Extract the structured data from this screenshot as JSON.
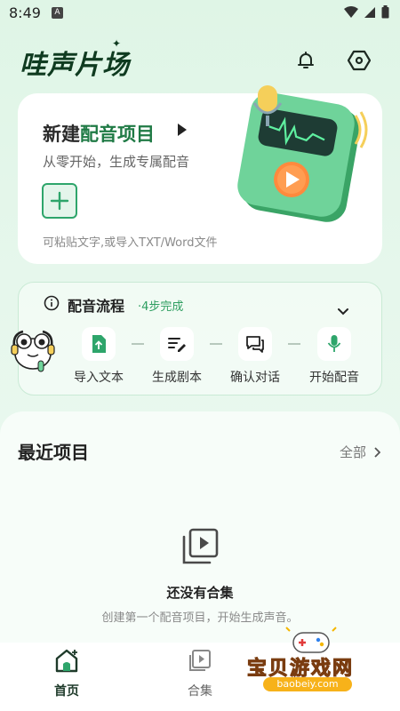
{
  "status": {
    "time": "8:49",
    "a_icon": "A"
  },
  "header": {
    "logo": "哇声片场",
    "bell_icon": "bell-icon",
    "settings_icon": "hexagon-settings-icon"
  },
  "new_project": {
    "title_part1": "新建",
    "title_part2": "配音项目",
    "subtitle": "从零开始，生成专属配音",
    "hint": "可粘贴文字,或导入TXT/Word文件"
  },
  "workflow": {
    "title": "配音流程",
    "steps_label": "·4步完成",
    "steps": [
      {
        "label": "导入文本",
        "icon": "upload-file-icon"
      },
      {
        "label": "生成剧本",
        "icon": "edit-script-icon"
      },
      {
        "label": "确认对话",
        "icon": "dialog-icon"
      },
      {
        "label": "开始配音",
        "icon": "mic-icon"
      }
    ]
  },
  "recent": {
    "title": "最近项目",
    "all_label": "全部",
    "empty_title": "还没有合集",
    "empty_sub": "创建第一个配音项目，开始生成声音。"
  },
  "tabs": [
    {
      "label": "首页",
      "active": true
    },
    {
      "label": "合集",
      "active": false
    }
  ],
  "watermark": {
    "text": "宝贝游戏网",
    "url": "baobeiy.com"
  },
  "colors": {
    "accent": "#1f7a45",
    "accent_light": "#2ea56b",
    "background": "#dff5e6"
  }
}
